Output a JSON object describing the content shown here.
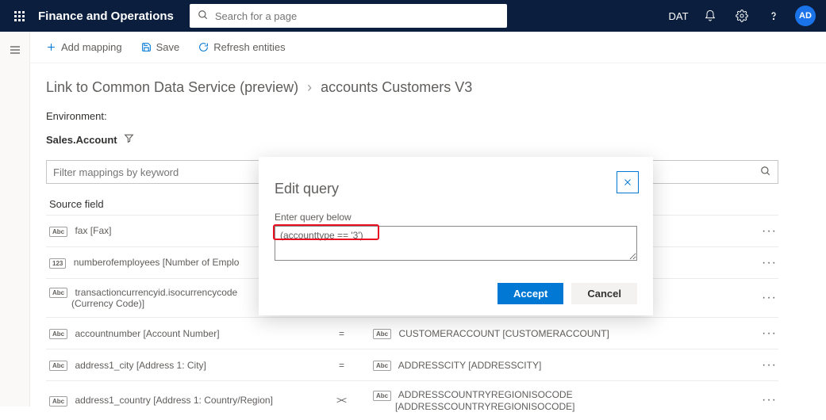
{
  "topbar": {
    "title": "Finance and Operations",
    "search_placeholder": "Search for a page",
    "company": "DAT",
    "avatar_initials": "AD"
  },
  "cmdbar": {
    "add_mapping": "Add mapping",
    "save": "Save",
    "refresh": "Refresh entities"
  },
  "breadcrumb": {
    "root": "Link to Common Data Service (preview)",
    "current": "accounts Customers V3"
  },
  "env_label": "Environment:",
  "entity": {
    "name": "Sales.Account"
  },
  "filter": {
    "placeholder": "Filter mappings by keyword"
  },
  "columns": {
    "source": "Source field"
  },
  "rows": [
    {
      "src_type": "Abc",
      "src": "fax [Fax]",
      "dir": "eq",
      "dst_type": "",
      "dst": ""
    },
    {
      "src_type": "123",
      "src": "numberofemployees [Number of Emplo",
      "dir": "eq",
      "dst_type": "",
      "dst": ""
    },
    {
      "src_type": "Abc",
      "src": "transactioncurrencyid.isocurrencycode",
      "src2": "(Currency Code)]",
      "dir": "eq",
      "dst_type": "",
      "dst": ""
    },
    {
      "src_type": "Abc",
      "src": "accountnumber [Account Number]",
      "dir": "eq",
      "dst_type": "Abc",
      "dst": "CUSTOMERACCOUNT [CUSTOMERACCOUNT]"
    },
    {
      "src_type": "Abc",
      "src": "address1_city [Address 1: City]",
      "dir": "eq",
      "dst_type": "Abc",
      "dst": "ADDRESSCITY [ADDRESSCITY]"
    },
    {
      "src_type": "Abc",
      "src": "address1_country [Address 1: Country/Region]",
      "dir": "lt",
      "dst_type": "Abc",
      "dst": "ADDRESSCOUNTRYREGIONISOCODE",
      "dst2": "[ADDRESSCOUNTRYREGIONISOCODE]"
    }
  ],
  "modal": {
    "title": "Edit query",
    "label": "Enter query below",
    "value": "(accounttype == '3')",
    "accept": "Accept",
    "cancel": "Cancel"
  }
}
